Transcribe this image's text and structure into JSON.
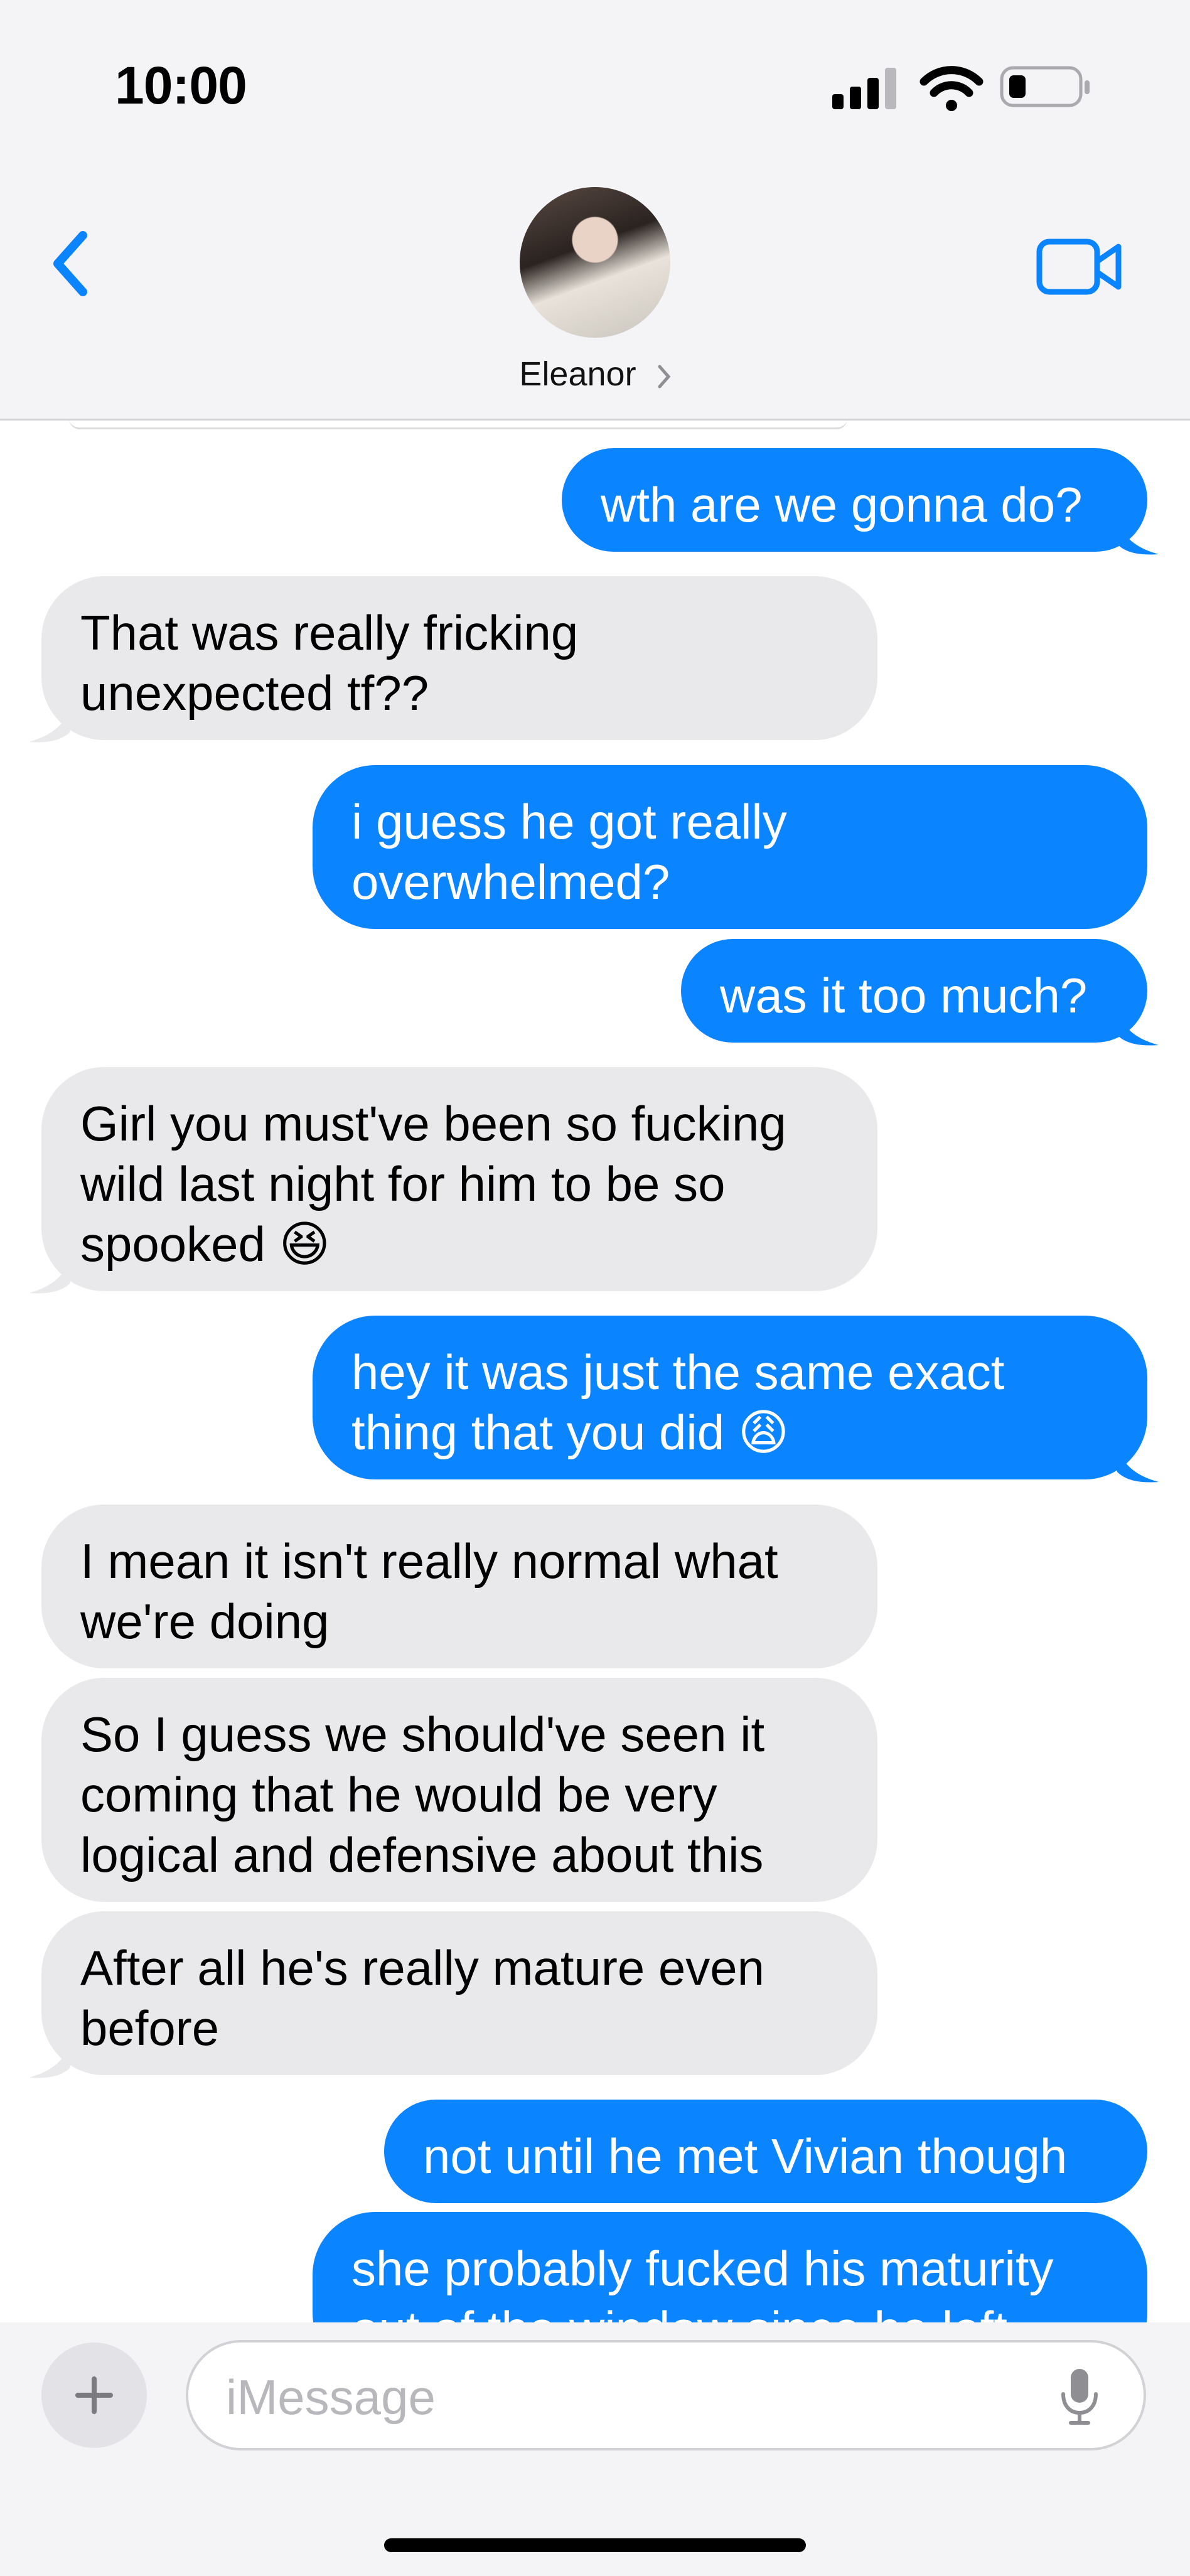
{
  "status_bar": {
    "time": "10:00"
  },
  "header": {
    "contact_name": "Eleanor"
  },
  "messages": [
    {
      "from": "me",
      "text": "wth are we gonna do?"
    },
    {
      "from": "other",
      "text": "That was really fricking\nunexpected tf??"
    },
    {
      "from": "me",
      "text": "i guess he got really\noverwhelmed?"
    },
    {
      "from": "me",
      "text": "was it too much?"
    },
    {
      "from": "other",
      "text": "Girl you must've been so fucking\nwild last night for him to be so\nspooked 😆"
    },
    {
      "from": "me",
      "text": "hey it was just the same exact\nthing that you did 😩"
    },
    {
      "from": "other",
      "text": "I mean it isn't really normal what\nwe're doing"
    },
    {
      "from": "other",
      "text": "So I guess we should've seen it\ncoming that he would be very\nlogical and defensive about this"
    },
    {
      "from": "other",
      "text": "After all he's really mature even\nbefore"
    },
    {
      "from": "me",
      "text": "not until he met Vivian though"
    },
    {
      "from": "me",
      "text": "she probably fucked his maturity\nout of the window since he left"
    }
  ],
  "composer": {
    "placeholder": "iMessage"
  },
  "colors": {
    "outgoing": "#0b84ff",
    "incoming": "#e9e9eb",
    "accent": "#0b84ff"
  }
}
